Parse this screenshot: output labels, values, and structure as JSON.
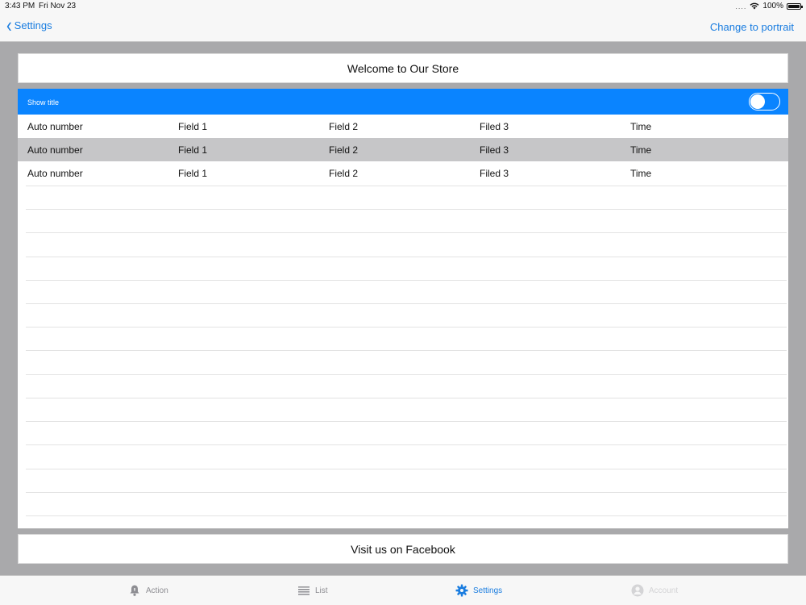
{
  "status_bar": {
    "time": "3:43 PM",
    "date": "Fri Nov 23",
    "battery": "100%"
  },
  "nav": {
    "back_label": "Settings",
    "right_action": "Change to portrait"
  },
  "content": {
    "title": "Welcome to Our Store",
    "show_title_label": "Show title",
    "show_title_toggle": false,
    "rows": [
      {
        "c1": "Auto number",
        "c2": "Field 1",
        "c3": "Field 2",
        "c4": "Filed 3",
        "c5": "Time"
      },
      {
        "c1": "Auto number",
        "c2": "Field 1",
        "c3": "Field 2",
        "c4": "Filed 3",
        "c5": "Time"
      },
      {
        "c1": "Auto number",
        "c2": "Field 1",
        "c3": "Field 2",
        "c4": "Filed 3",
        "c5": "Time"
      }
    ],
    "footer_button": "Visit us on Facebook"
  },
  "tab_bar": {
    "tabs": [
      {
        "label": "Action",
        "icon": "bell-icon",
        "state": "normal"
      },
      {
        "label": "List",
        "icon": "list-icon",
        "state": "normal"
      },
      {
        "label": "Settings",
        "icon": "gear-icon",
        "state": "active"
      },
      {
        "label": "Account",
        "icon": "person-icon",
        "state": "disabled"
      }
    ]
  },
  "colors": {
    "accent": "#1a7de0",
    "header_bar": "#0a84ff",
    "background": "#a9a9ab",
    "selected_row": "#c6c6c8"
  }
}
